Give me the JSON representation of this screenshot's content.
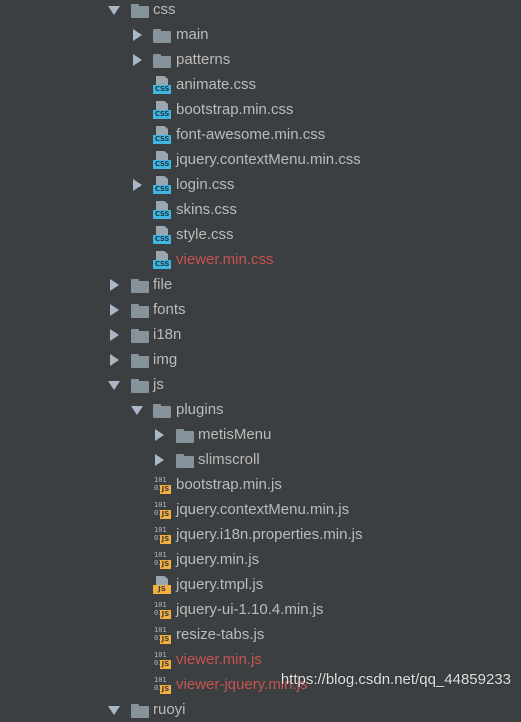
{
  "tree": {
    "rows": [
      {
        "label": "css",
        "kind": "folder",
        "level": 1,
        "arrow": "down"
      },
      {
        "label": "main",
        "kind": "folder",
        "level": 2,
        "arrow": "right"
      },
      {
        "label": "patterns",
        "kind": "folder",
        "level": 2,
        "arrow": "right"
      },
      {
        "label": "animate.css",
        "kind": "css",
        "level": 2,
        "arrow": "none"
      },
      {
        "label": "bootstrap.min.css",
        "kind": "css",
        "level": 2,
        "arrow": "none"
      },
      {
        "label": "font-awesome.min.css",
        "kind": "css",
        "level": 2,
        "arrow": "none"
      },
      {
        "label": "jquery.contextMenu.min.css",
        "kind": "css",
        "level": 2,
        "arrow": "none"
      },
      {
        "label": "login.css",
        "kind": "css",
        "level": 2,
        "arrow": "right"
      },
      {
        "label": "skins.css",
        "kind": "css",
        "level": 2,
        "arrow": "none"
      },
      {
        "label": "style.css",
        "kind": "css",
        "level": 2,
        "arrow": "none"
      },
      {
        "label": "viewer.min.css",
        "kind": "css",
        "level": 2,
        "arrow": "none",
        "changed": true
      },
      {
        "label": "file",
        "kind": "folder",
        "level": 1,
        "arrow": "right"
      },
      {
        "label": "fonts",
        "kind": "folder",
        "level": 1,
        "arrow": "right"
      },
      {
        "label": "i18n",
        "kind": "folder",
        "level": 1,
        "arrow": "right"
      },
      {
        "label": "img",
        "kind": "folder",
        "level": 1,
        "arrow": "right"
      },
      {
        "label": "js",
        "kind": "folder",
        "level": 1,
        "arrow": "down"
      },
      {
        "label": "plugins",
        "kind": "folder",
        "level": 2,
        "arrow": "down"
      },
      {
        "label": "metisMenu",
        "kind": "folder",
        "level": 3,
        "arrow": "right"
      },
      {
        "label": "slimscroll",
        "kind": "folder",
        "level": 3,
        "arrow": "right"
      },
      {
        "label": "bootstrap.min.js",
        "kind": "js-min",
        "level": 2,
        "arrow": "none"
      },
      {
        "label": "jquery.contextMenu.min.js",
        "kind": "js-min",
        "level": 2,
        "arrow": "none"
      },
      {
        "label": "jquery.i18n.properties.min.js",
        "kind": "js-min",
        "level": 2,
        "arrow": "none"
      },
      {
        "label": "jquery.min.js",
        "kind": "js-min",
        "level": 2,
        "arrow": "none"
      },
      {
        "label": "jquery.tmpl.js",
        "kind": "js",
        "level": 2,
        "arrow": "none"
      },
      {
        "label": "jquery-ui-1.10.4.min.js",
        "kind": "js-min",
        "level": 2,
        "arrow": "none"
      },
      {
        "label": "resize-tabs.js",
        "kind": "js-min",
        "level": 2,
        "arrow": "none"
      },
      {
        "label": "viewer.min.js",
        "kind": "js-min",
        "level": 2,
        "arrow": "none",
        "changed": true
      },
      {
        "label": "viewer-jquery.min.js",
        "kind": "js-min",
        "level": 2,
        "arrow": "none",
        "changed": true
      },
      {
        "label": "ruoyi",
        "kind": "folder",
        "level": 1,
        "arrow": "down"
      }
    ]
  },
  "icons": {
    "css_tag": "CSS",
    "js_tag": "JS",
    "min_binary_top": "101",
    "min_binary_bottom": "01"
  },
  "watermark": "https://blog.csdn.net/qq_44859233",
  "colors": {
    "background": "#3c3f41",
    "text": "#bbbbbb",
    "changed": "#c75450",
    "folder": "#87939a",
    "css": "#40b6e0",
    "js": "#f4af3d"
  }
}
